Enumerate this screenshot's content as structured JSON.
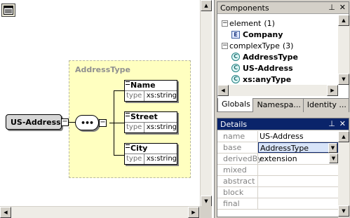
{
  "design": {
    "toolbar_icon": "diagram-view-icon",
    "complex_type_label": "AddressType",
    "root_element": "US-Address",
    "compositor_symbol": "•••",
    "expander_minus": "−",
    "children": [
      {
        "name": "Name",
        "type_key": "type",
        "type_value": "xs:string"
      },
      {
        "name": "Street",
        "type_key": "type",
        "type_value": "xs:string"
      },
      {
        "name": "City",
        "type_key": "type",
        "type_value": "xs:string"
      }
    ]
  },
  "components_panel": {
    "title": "Components",
    "pin_icon": "pin-icon",
    "close_icon": "close-icon",
    "tree": [
      {
        "label": "element",
        "count": "(1)",
        "kind": "group"
      },
      {
        "label": "Company",
        "kind": "element",
        "badge": "E"
      },
      {
        "label": "complexType",
        "count": "(3)",
        "kind": "group"
      },
      {
        "label": "AddressType",
        "kind": "complex",
        "badge": "C"
      },
      {
        "label": "US-Address",
        "kind": "complex",
        "badge": "C"
      },
      {
        "label": "xs:anyType",
        "kind": "complex",
        "badge": "C"
      }
    ],
    "tabs": [
      "Globals",
      "Namespa...",
      "Identity ..."
    ]
  },
  "details_panel": {
    "title": "Details",
    "rows": [
      {
        "key": "name",
        "value": "US-Address"
      },
      {
        "key": "base",
        "value": "AddressType"
      },
      {
        "key": "derivedBy",
        "value": "extension"
      },
      {
        "key": "mixed",
        "value": ""
      },
      {
        "key": "abstract",
        "value": ""
      },
      {
        "key": "block",
        "value": ""
      },
      {
        "key": "final",
        "value": ""
      }
    ]
  },
  "colors": {
    "complex_type_fill": "#ffffc0",
    "title_bar_active": "#0a246a",
    "element_box": "#d6d6d6"
  }
}
